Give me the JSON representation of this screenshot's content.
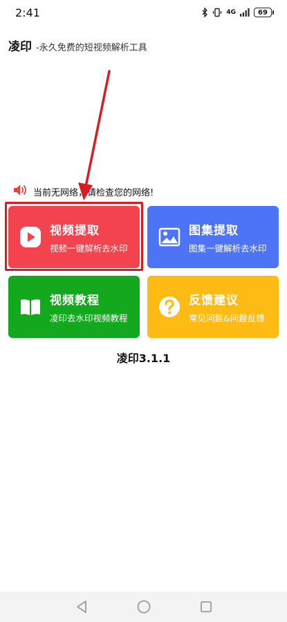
{
  "status_bar": {
    "time": "2:41",
    "network_type": "4G",
    "battery_level": "69"
  },
  "header": {
    "title": "凌印",
    "subtitle": "-永久免费的短视频解析工具"
  },
  "notice": {
    "text": "当前无网络，请检查您的网络!"
  },
  "cards": [
    {
      "title": "视频提取",
      "subtitle": "视频一键解析去水印",
      "color": "#f2434e",
      "icon": "play-icon"
    },
    {
      "title": "图集提取",
      "subtitle": "图集一键解析去水印",
      "color": "#4d73f7",
      "icon": "image-icon"
    },
    {
      "title": "视频教程",
      "subtitle": "凌印去水印视频教程",
      "color": "#14a81f",
      "icon": "book-icon"
    },
    {
      "title": "反馈建议",
      "subtitle": "常见问题&问题反馈",
      "color": "#fdbb13",
      "icon": "question-icon"
    }
  ],
  "version": "凌印3.1.1",
  "annotation": {
    "color": "#d71d22"
  }
}
